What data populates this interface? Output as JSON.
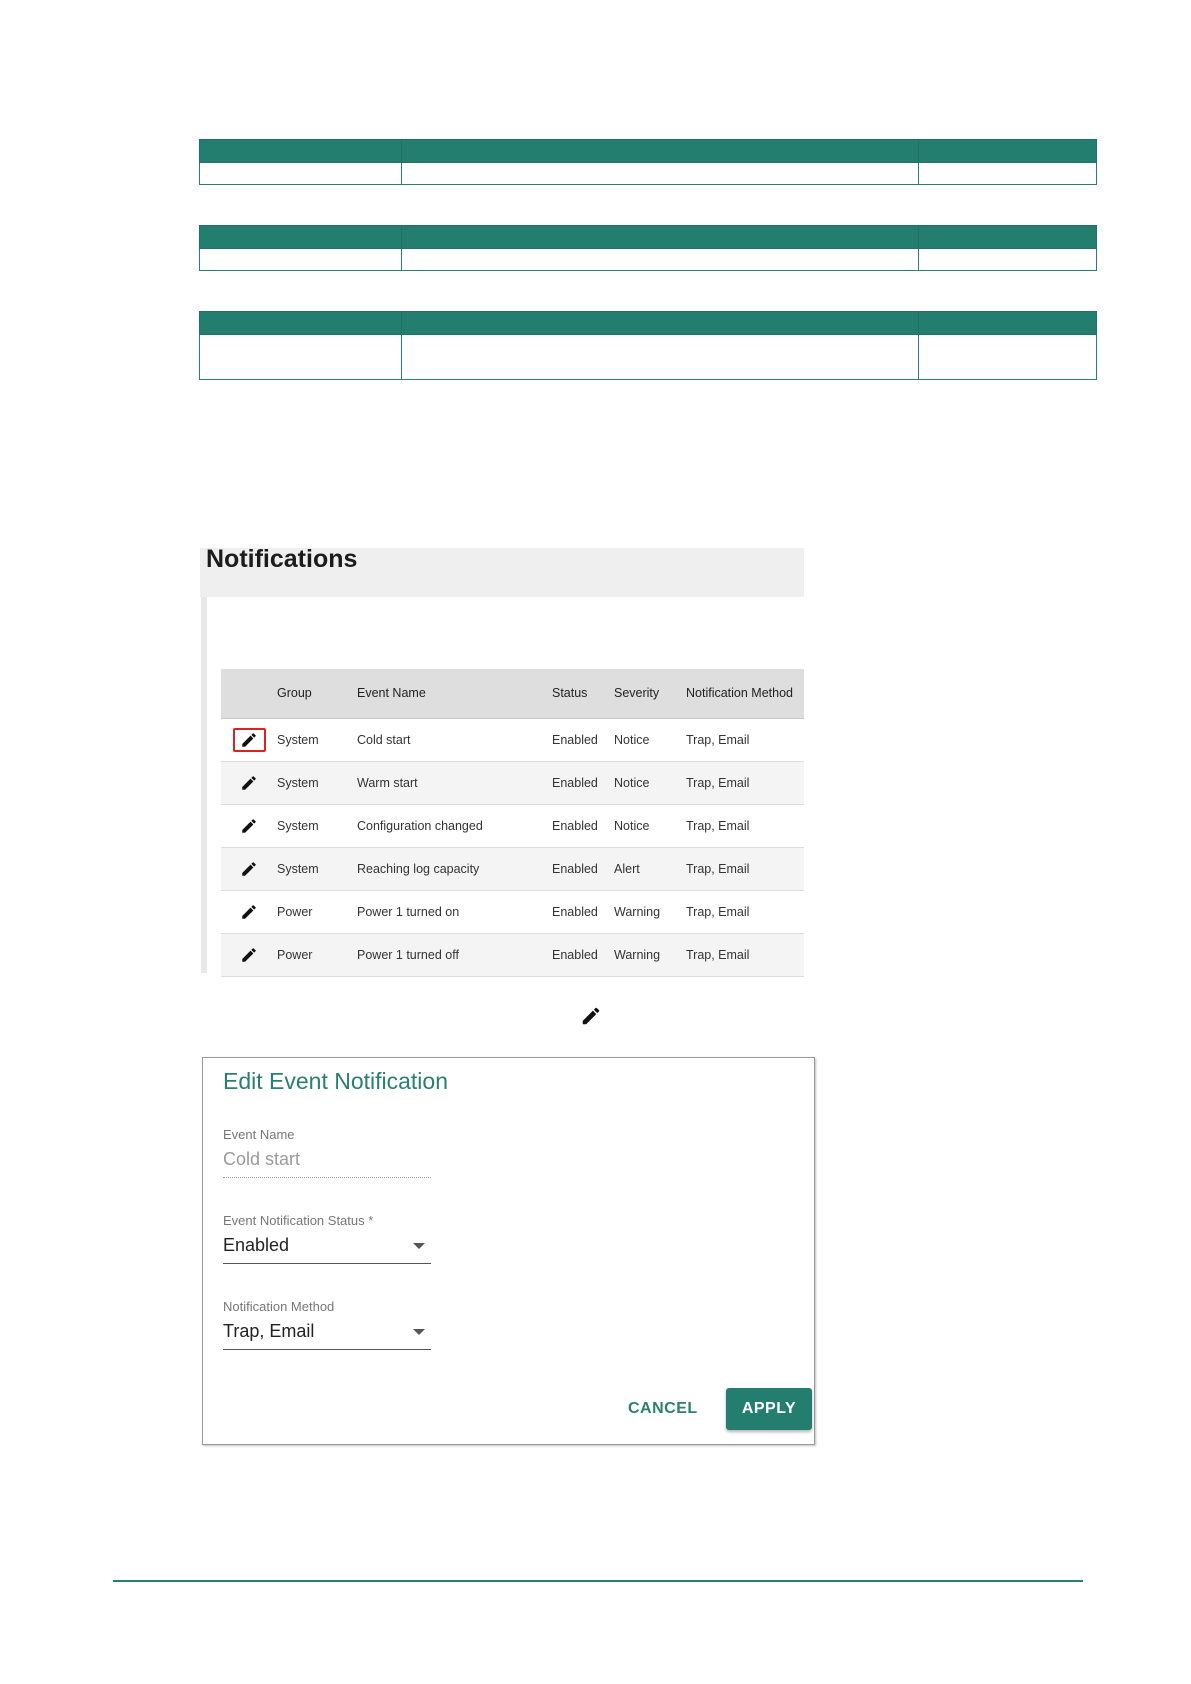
{
  "colors": {
    "accent": "#237e70",
    "highlight_box": "#e02020"
  },
  "notifications": {
    "title": "Notifications",
    "columns": [
      "",
      "Group",
      "Event Name",
      "Status",
      "Severity",
      "Notification Method"
    ],
    "rows": [
      {
        "group": "System",
        "event": "Cold start",
        "status": "Enabled",
        "severity": "Notice",
        "method": "Trap, Email"
      },
      {
        "group": "System",
        "event": "Warm start",
        "status": "Enabled",
        "severity": "Notice",
        "method": "Trap, Email"
      },
      {
        "group": "System",
        "event": "Configuration changed",
        "status": "Enabled",
        "severity": "Notice",
        "method": "Trap, Email"
      },
      {
        "group": "System",
        "event": "Reaching log capacity",
        "status": "Enabled",
        "severity": "Alert",
        "method": "Trap, Email"
      },
      {
        "group": "Power",
        "event": "Power 1 turned on",
        "status": "Enabled",
        "severity": "Warning",
        "method": "Trap, Email"
      },
      {
        "group": "Power",
        "event": "Power 1 turned off",
        "status": "Enabled",
        "severity": "Warning",
        "method": "Trap, Email"
      }
    ],
    "edit_icon": "pencil-icon"
  },
  "dialog": {
    "title": "Edit Event Notification",
    "event_name": {
      "label": "Event Name",
      "value": "Cold start"
    },
    "status": {
      "label": "Event Notification Status *",
      "value": "Enabled"
    },
    "method": {
      "label": "Notification Method",
      "value": "Trap, Email"
    },
    "cancel_label": "CANCEL",
    "apply_label": "APPLY"
  }
}
